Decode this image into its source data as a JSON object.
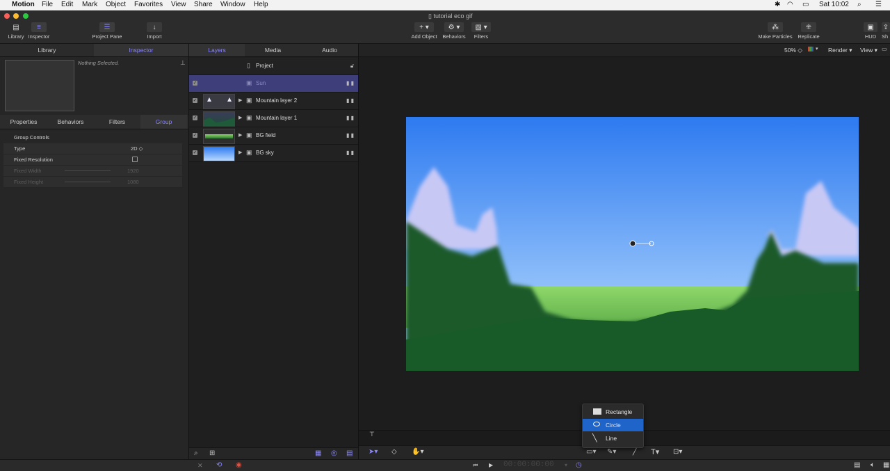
{
  "menubar": {
    "app": "Motion",
    "items": [
      "File",
      "Edit",
      "Mark",
      "Object",
      "Favorites",
      "View",
      "Share",
      "Window",
      "Help"
    ],
    "clock": "Sat 10:02"
  },
  "window": {
    "title": "tutorial eco gif"
  },
  "toolbar": {
    "library": "Library",
    "inspector": "Inspector",
    "project_pane": "Project Pane",
    "import": "Import",
    "add_object": "Add Object",
    "behaviors": "Behaviors",
    "filters": "Filters",
    "make_particles": "Make Particles",
    "replicate": "Replicate",
    "hud": "HUD",
    "share_cut": "Sh"
  },
  "left_panel": {
    "tabs": [
      "Library",
      "Inspector"
    ],
    "active_tab": "Inspector",
    "preview_text": "Nothing Selected.",
    "inspector_tabs": [
      "Properties",
      "Behaviors",
      "Filters",
      "Group"
    ],
    "active_inspector_tab": "Group",
    "group_controls_label": "Group Controls",
    "props": [
      {
        "label": "Type",
        "value": "2D ◇"
      },
      {
        "label": "Fixed Resolution",
        "value": ""
      },
      {
        "label": "Fixed Width",
        "value": "1920"
      },
      {
        "label": "Fixed Height",
        "value": "1080"
      }
    ]
  },
  "middle_panel": {
    "tabs": [
      "Layers",
      "Media",
      "Audio"
    ],
    "active_tab": "Layers",
    "project_label": "Project",
    "layers": [
      {
        "label": "Sun",
        "selected": true
      },
      {
        "label": "Mountain layer 2",
        "selected": false
      },
      {
        "label": "Mountain layer 1",
        "selected": false
      },
      {
        "label": "BG field",
        "selected": false
      },
      {
        "label": "BG sky",
        "selected": false
      }
    ]
  },
  "canvas": {
    "zoom": "50% ◇",
    "render": "Render ▾",
    "view": "View ▾"
  },
  "shape_menu": {
    "items": [
      "Rectangle",
      "Circle",
      "Line"
    ],
    "selected": "Circle"
  },
  "timecode": "00:00:00:00",
  "colors": {
    "accent": "#8a86ff",
    "selected_layer": "#3e3e7a",
    "menu_highlight": "#1f64c8",
    "sky_top": "#2d7af0",
    "sky_bottom": "#9cc8fb",
    "field": "#1c5a2a",
    "grass": "#8fd86a",
    "snow": "#c8c8f5"
  }
}
